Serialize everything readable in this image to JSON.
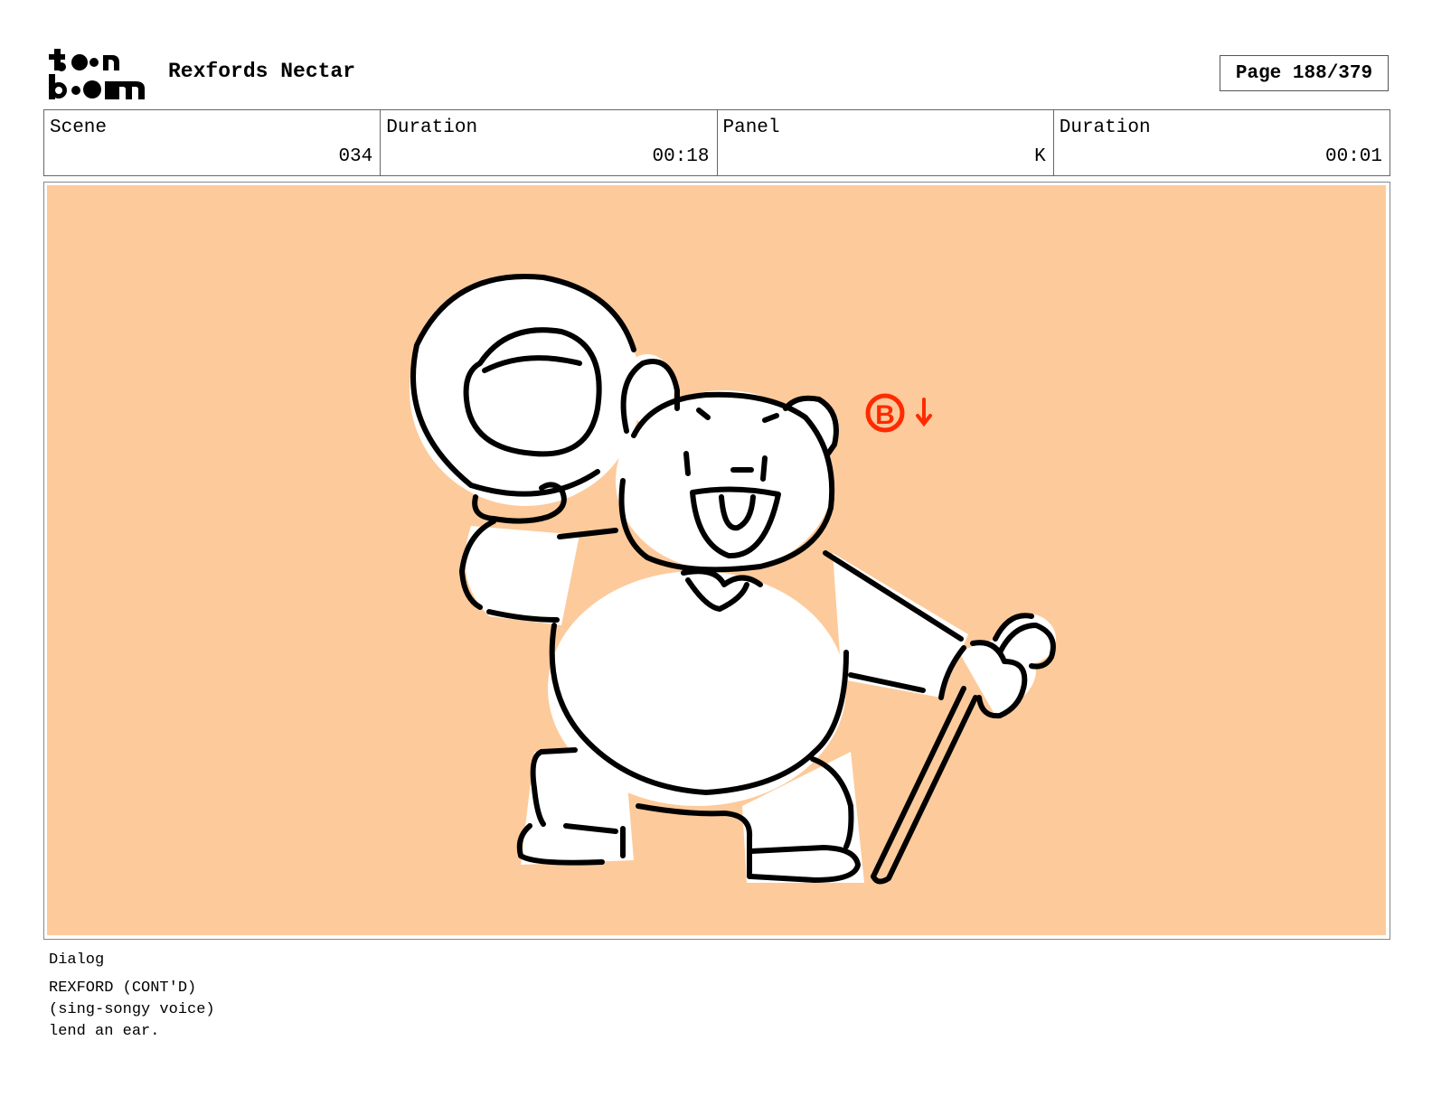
{
  "header": {
    "logo_text": "toon boom",
    "project_title": "Rexfords Nectar",
    "page_indicator": "Page 188/379"
  },
  "info": {
    "scene_label": "Scene",
    "scene_value": "034",
    "scene_duration_label": "Duration",
    "scene_duration_value": "00:18",
    "panel_label": "Panel",
    "panel_value": "K",
    "panel_duration_label": "Duration",
    "panel_duration_value": "00:01"
  },
  "panel": {
    "background_color": "#fdca9b",
    "annotation_color": "#ff2a00",
    "annotation_symbol": "B"
  },
  "dialog": {
    "label": "Dialog",
    "lines": [
      "REXFORD (CONT'D)",
      "(sing-songy voice)",
      "lend an ear."
    ]
  }
}
